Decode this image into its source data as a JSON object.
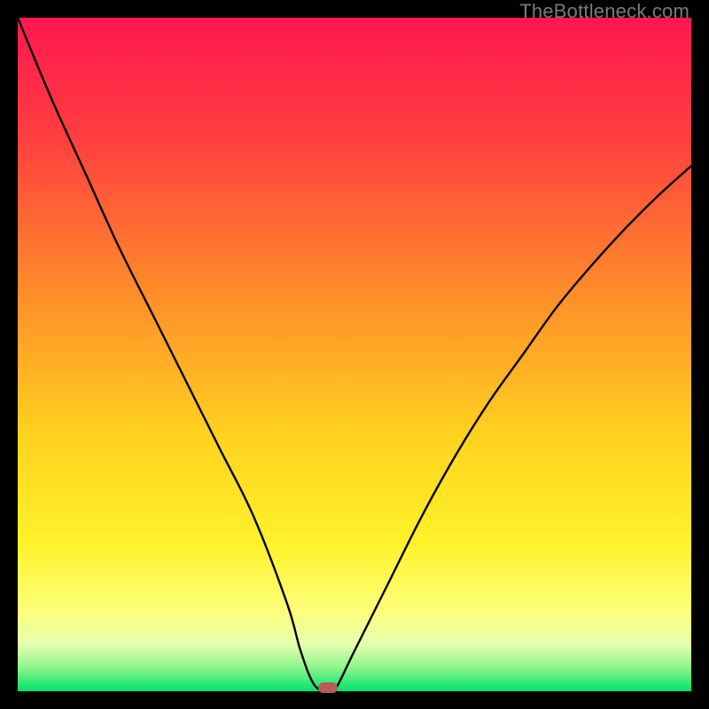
{
  "watermark": "TheBottleneck.com",
  "chart_data": {
    "type": "line",
    "title": "",
    "xlabel": "",
    "ylabel": "",
    "xlim": [
      0,
      100
    ],
    "ylim": [
      0,
      100
    ],
    "grid": false,
    "legend": false,
    "background_gradient": {
      "stops": [
        {
          "pos": 0.0,
          "color": "#ff1751"
        },
        {
          "pos": 0.18,
          "color": "#ff3f3f"
        },
        {
          "pos": 0.4,
          "color": "#ff8a2a"
        },
        {
          "pos": 0.62,
          "color": "#ffd21f"
        },
        {
          "pos": 0.78,
          "color": "#fff22a"
        },
        {
          "pos": 0.88,
          "color": "#fdff7a"
        },
        {
          "pos": 0.93,
          "color": "#e6ffb0"
        },
        {
          "pos": 0.965,
          "color": "#8cf58c"
        },
        {
          "pos": 1.0,
          "color": "#00e36b"
        }
      ]
    },
    "series": [
      {
        "name": "bottleneck-curve",
        "x": [
          0,
          5,
          10,
          15,
          20,
          25,
          30,
          35,
          40,
          42,
          44,
          46,
          47,
          50,
          55,
          60,
          65,
          70,
          75,
          80,
          85,
          90,
          95,
          100
        ],
        "y": [
          100,
          88,
          77,
          66,
          56,
          46,
          36,
          26,
          13,
          6,
          1,
          0,
          0,
          6,
          16,
          26,
          35,
          43,
          50,
          57,
          63,
          68.5,
          73.5,
          78
        ]
      }
    ],
    "markers": [
      {
        "name": "optimal-point",
        "x": 46,
        "y": 0.5,
        "color": "#b95a55",
        "shape": "rounded-rect"
      }
    ],
    "frame_color": "#000000"
  }
}
